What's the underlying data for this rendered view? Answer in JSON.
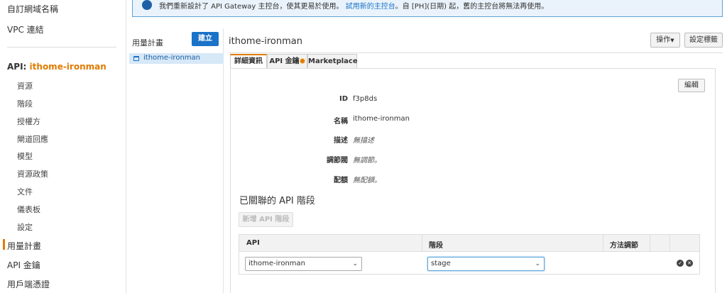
{
  "sidebar": {
    "top_items": [
      "自訂網域名稱",
      "VPC 連結"
    ],
    "api_prefix": "API:",
    "api_name": "ithome-ironman",
    "sub_items": [
      "資源",
      "階段",
      "授權方",
      "閘道回應",
      "模型",
      "資源政策",
      "文件",
      "儀表板",
      "設定"
    ],
    "main_items": [
      "用量計畫",
      "API 金鑰",
      "用戶端憑證"
    ]
  },
  "notice": {
    "text_before": "我們重新設計了 API Gateway 主控台，使其更易於使用。",
    "link": "試用新的主控台",
    "text_after": "。自 [PH](日期) 起，舊的主控台將無法再使用。"
  },
  "plans": {
    "title": "用量計畫",
    "create_label": "建立",
    "items": [
      "ithome-ironman"
    ]
  },
  "main": {
    "title": "ithome-ironman",
    "actions_label": "操作",
    "tags_label": "設定標籤",
    "tabs": [
      "詳細資訊",
      "API 金鑰",
      "Marketplace"
    ],
    "edit_label": "編輯",
    "fields": [
      {
        "label": "ID",
        "value": "f3p8ds"
      },
      {
        "label": "名稱",
        "value": "ithome-ironman"
      },
      {
        "label": "描述",
        "value": "無描述"
      },
      {
        "label": "調節閥",
        "value": "無調節。"
      },
      {
        "label": "配額",
        "value": "無配額。"
      }
    ],
    "section_title": "已關聯的 API 階段",
    "add_stage_label": "新增 API 階段",
    "table": {
      "headers": [
        "API",
        "階段",
        "方法調節"
      ],
      "row": {
        "api": "ithome-ironman",
        "stage": "stage"
      }
    }
  },
  "icons": {
    "notice": "info-icon",
    "plan": "usage-plan-icon",
    "tab_badge": "new-badge-icon",
    "confirm": "check-circle-icon",
    "cancel": "close-circle-icon"
  },
  "colors": {
    "accent": "#e07b00",
    "primary": "#1a73c8",
    "notice_bg": "#eaf3fb"
  }
}
